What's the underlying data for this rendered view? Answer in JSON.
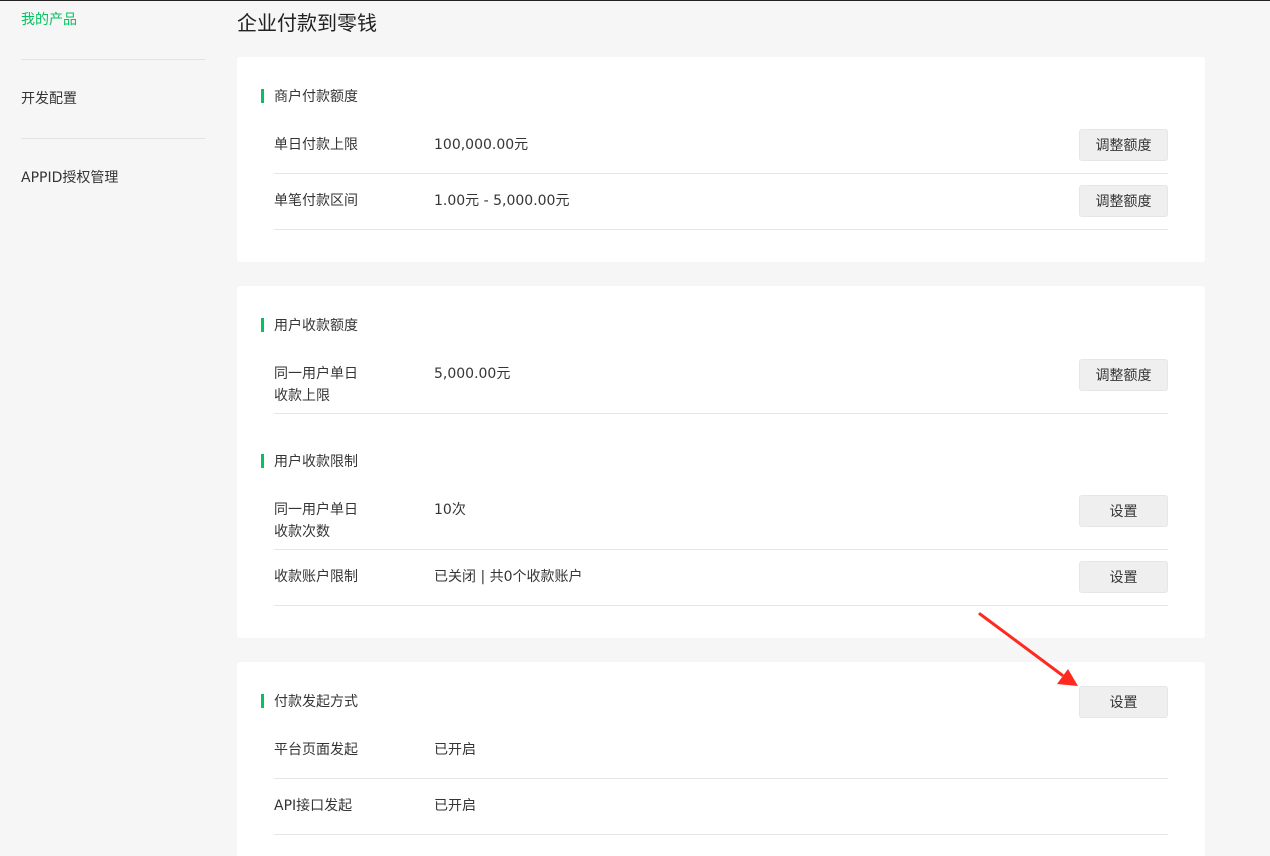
{
  "sidebar": {
    "items": [
      {
        "label": "我的产品"
      },
      {
        "label": "开发配置"
      },
      {
        "label": "APPID授权管理"
      }
    ]
  },
  "page": {
    "title": "企业付款到零钱"
  },
  "merchant_limit": {
    "title": "商户付款额度",
    "rows": [
      {
        "label": "单日付款上限",
        "value": "100,000.00元",
        "button": "调整额度"
      },
      {
        "label": "单笔付款区间",
        "value": "1.00元 - 5,000.00元",
        "button": "调整额度"
      }
    ]
  },
  "user_limit": {
    "title": "用户收款额度",
    "rows": [
      {
        "label": "同一用户单日收款上限",
        "value": "5,000.00元",
        "button": "调整额度"
      }
    ]
  },
  "user_restrict": {
    "title": "用户收款限制",
    "rows": [
      {
        "label": "同一用户单日收款次数",
        "value": "10次",
        "button": "设置"
      },
      {
        "label": "收款账户限制",
        "value": "已关闭 | 共0个收款账户",
        "button": "设置"
      }
    ]
  },
  "pay_method": {
    "title": "付款发起方式",
    "button": "设置",
    "rows": [
      {
        "label": "平台页面发起",
        "value": "已开启"
      },
      {
        "label": "API接口发起",
        "value": "已开启"
      }
    ]
  },
  "colors": {
    "accent": "#07c160",
    "annotation_arrow": "#ff2a1f"
  }
}
